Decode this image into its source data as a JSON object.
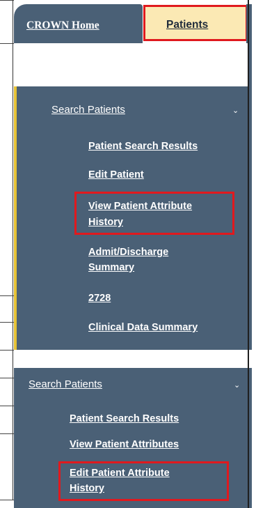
{
  "tabs": {
    "home_label": "CROWN Home",
    "patients_label": "Patients"
  },
  "upper_section": {
    "heading": "Search Patients",
    "items": [
      {
        "label": "Patient Search Results"
      },
      {
        "label": "Edit Patient"
      },
      {
        "label_line1": "View Patient Attribute",
        "label_line2": "History",
        "highlighted": true
      },
      {
        "label_line1": "Admit/Discharge",
        "label_line2": "Summary"
      },
      {
        "label": "2728"
      },
      {
        "label": "Clinical Data Summary"
      }
    ]
  },
  "lower_section": {
    "heading": "Search Patients",
    "items": [
      {
        "label": "Patient Search Results"
      },
      {
        "label": "View Patient Attributes"
      },
      {
        "label_line1": "Edit Patient Attribute",
        "label_line2": "History",
        "highlighted": true
      }
    ]
  },
  "colors": {
    "nav_bg": "#4a6076",
    "highlight_border": "#e0191e",
    "active_tab_bg": "#fbe9b4",
    "accent": "#e5c136"
  },
  "icons": {
    "expand": "chevron-down-icon"
  }
}
